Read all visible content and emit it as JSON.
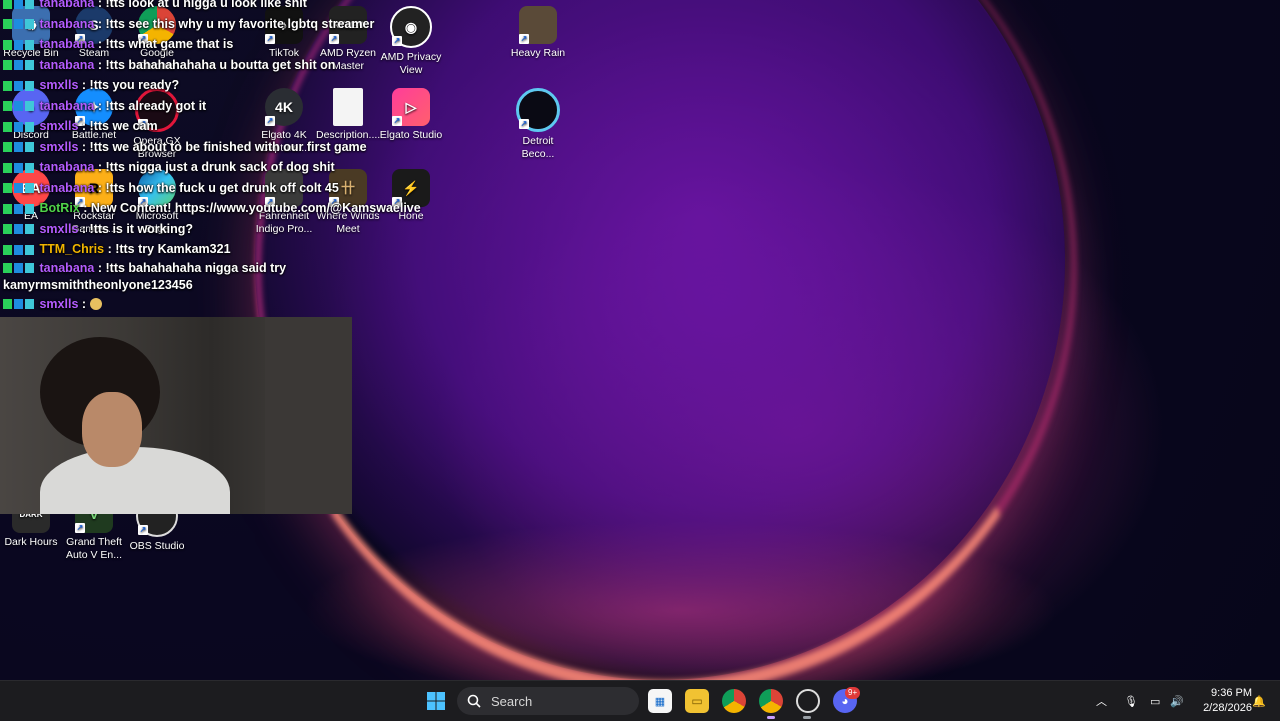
{
  "desktop_icons": {
    "recycle_bin": "Recycle Bin",
    "steam": "Steam",
    "google_chrome": "Google Chrome",
    "tiktok": "TikTok",
    "amd_ryzen": "AMD Ryzen Master",
    "amd_privacy": "AMD Privacy View",
    "heavy_rain": "Heavy Rain",
    "discord": "Discord",
    "battlenet": "Battle.net",
    "opera_gx": "Opera GX Browser",
    "elgato_4k": "Elgato 4K Capture...",
    "description": "Description....",
    "elgato_studio": "Elgato Studio",
    "detroit": "Detroit Beco...",
    "ea": "EA",
    "rockstar": "Rockstar Games ...",
    "edge": "Microsoft Edge",
    "fahrenheit": "Fahrenheit Indigo Pro...",
    "where_winds": "Where Winds Meet",
    "hone": "Hone",
    "dark_hours": "Dark Hours",
    "gta": "Grand Theft Auto V En...",
    "obs": "OBS Studio"
  },
  "chat": [
    {
      "user": "tanabana",
      "msg": ": !tts look at u nigga u look like shit"
    },
    {
      "user": "tanabana",
      "msg": ": !tts see this why u my favorite lgbtq streamer"
    },
    {
      "user": "tanabana",
      "msg": ": !tts what game that is"
    },
    {
      "user": "tanabana",
      "msg": ": !tts bahahahahaha u boutta get shit on"
    },
    {
      "user": "smxlls",
      "msg": ": !tts you ready?"
    },
    {
      "user": "tanabana",
      "msg": ": !tts already got it"
    },
    {
      "user": "smxlls",
      "msg": ": !tts we cam"
    },
    {
      "user": "smxlls",
      "msg": ": !tts we about to be finished with our first game"
    },
    {
      "user": "tanabana",
      "msg": ": !tts nigga just a drunk sack of dog shit"
    },
    {
      "user": "tanabana",
      "msg": ": !tts how the fuck u get drunk off colt 45"
    },
    {
      "user": "BotRix",
      "msg": ": New Content! https://www.youtube.com/@Kamswaelive"
    },
    {
      "user": "smxlls",
      "msg": ": !tts is it working?"
    },
    {
      "user": "TTM_Chris",
      "msg": ": !tts try Kamkam321"
    },
    {
      "user": "tanabana",
      "msg": ": !tts bahahahaha nigga said try kamyrmsmiththeonlyone123456"
    },
    {
      "user": "smxlls",
      "msg": ":"
    }
  ],
  "taskbar": {
    "search_label": "Search",
    "time": "9:36 PM",
    "date": "2/28/2026",
    "discord_badge": "9+"
  }
}
